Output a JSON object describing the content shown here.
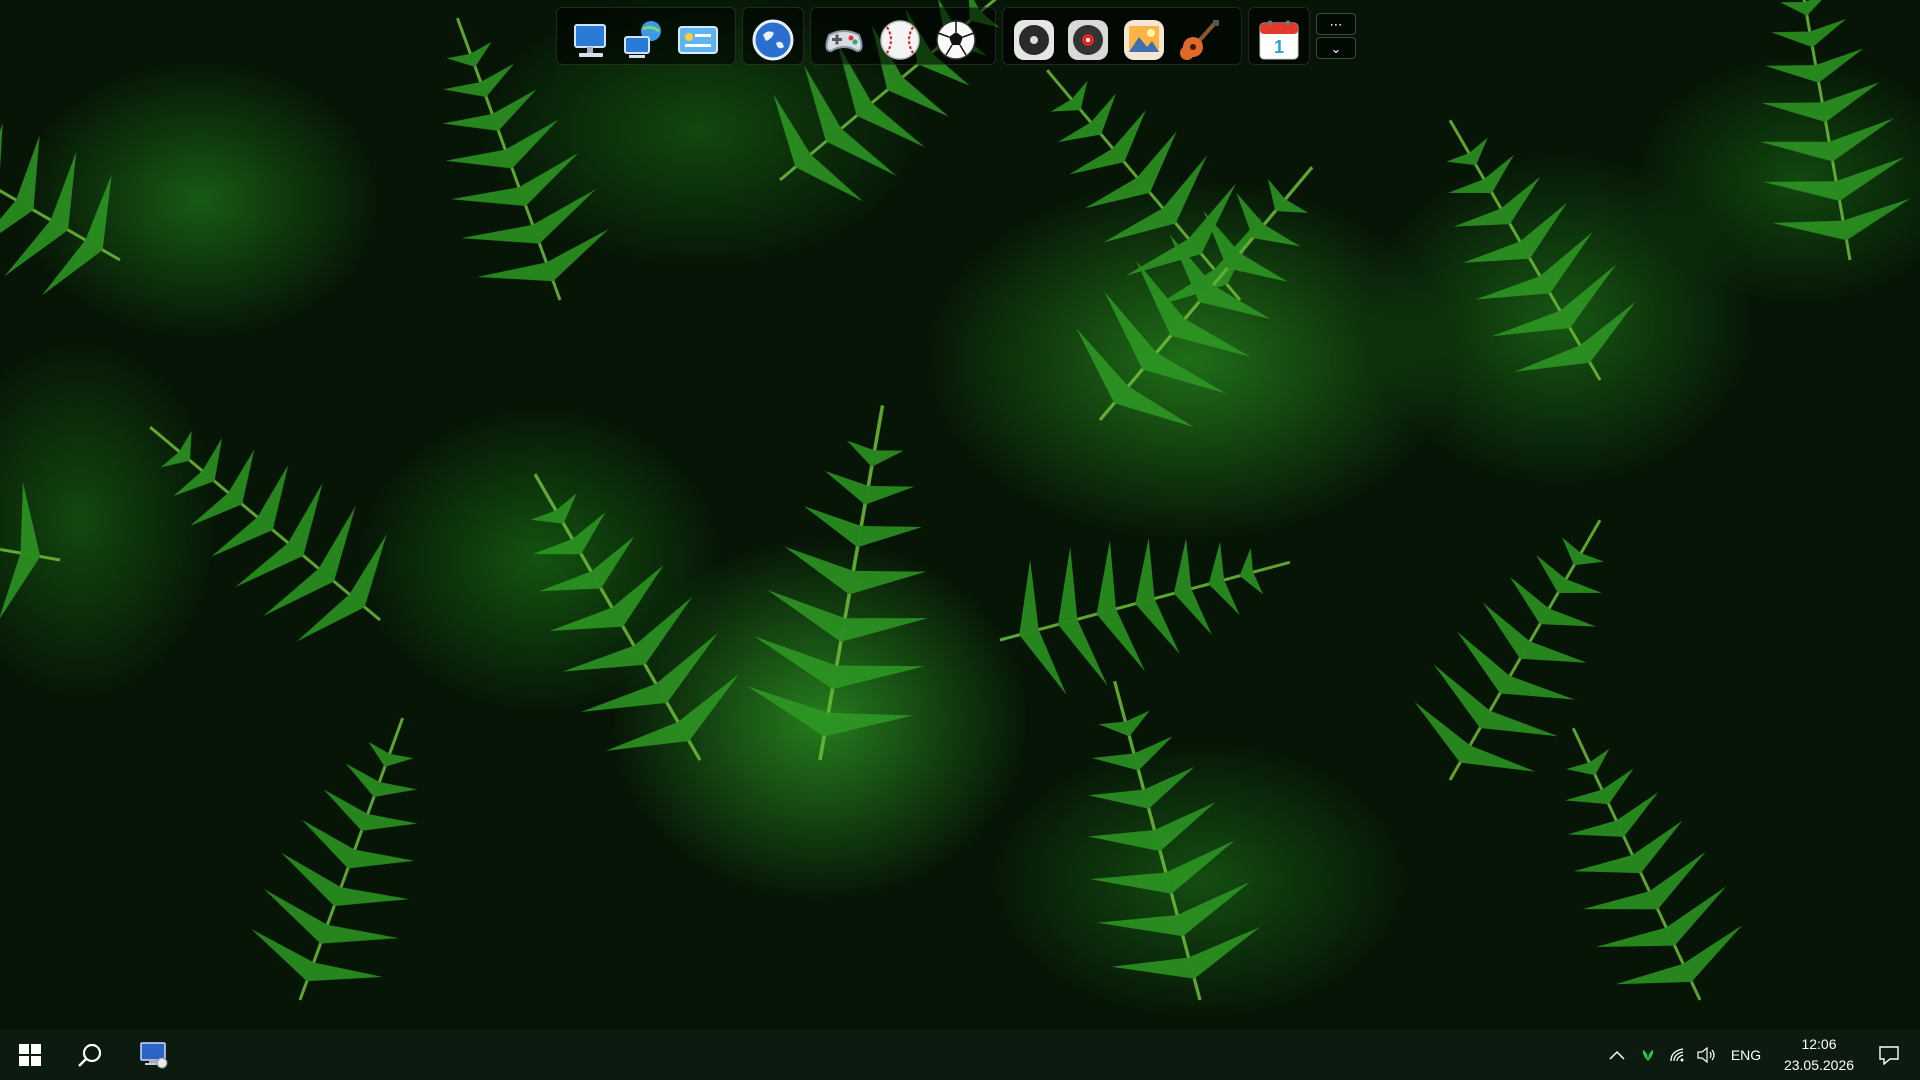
{
  "desktop": {
    "wallpaper": "fern-leaves",
    "accent_color": "#2c8f1f"
  },
  "dock": {
    "groups": [
      {
        "icons": [
          "computer-icon",
          "network-computer-icon",
          "control-panel-icon"
        ]
      },
      {
        "icons": [
          "globe-browser-icon"
        ]
      },
      {
        "icons": [
          "gamepad-icon",
          "baseball-icon",
          "soccer-ball-icon"
        ]
      },
      {
        "icons": [
          "music-disc-icon",
          "media-player-icon",
          "photos-icon",
          "guitar-icon"
        ]
      },
      {
        "icons": [
          "calendar-icon"
        ]
      }
    ],
    "calendar_day": "1",
    "more_label": "⋯",
    "collapse_label": "⌄"
  },
  "taskbar": {
    "start_icon": "windows-logo-icon",
    "search_icon": "search-icon",
    "pinned": [
      "remote-desktop-icon"
    ],
    "tray": {
      "language": "ENG",
      "time": "12:06",
      "date": "23.05.2026"
    }
  }
}
